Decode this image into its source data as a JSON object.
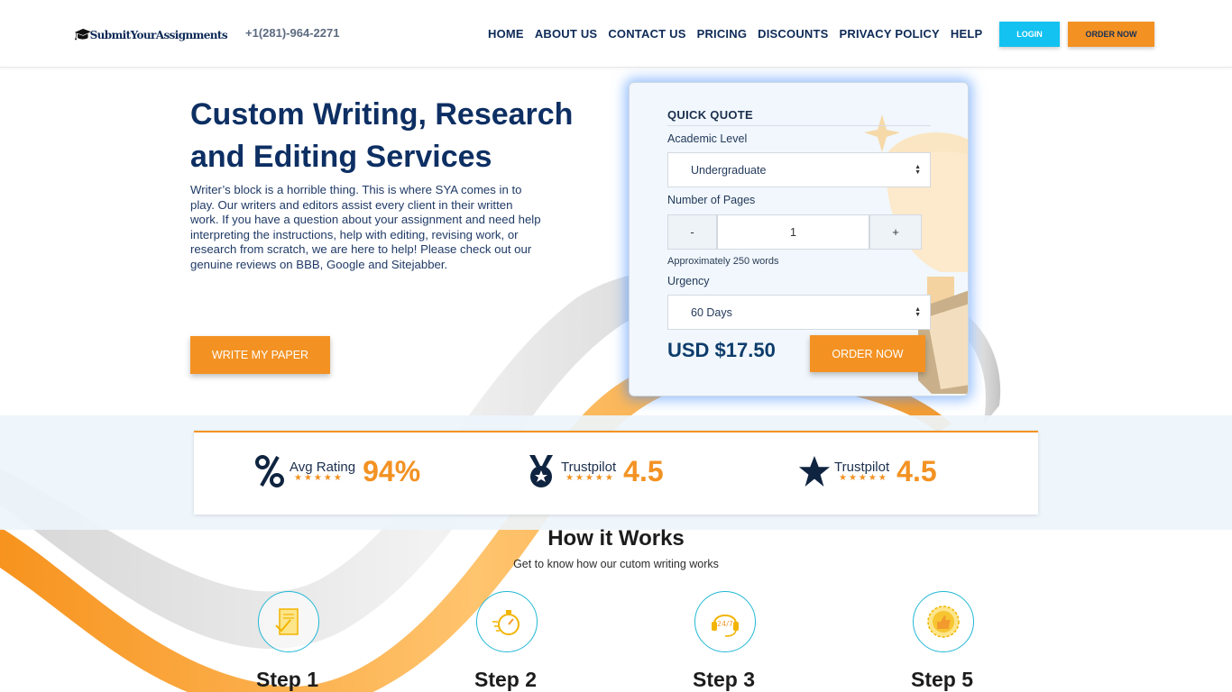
{
  "header": {
    "logo_text": "SubmitYourAssignments",
    "phone": "+1(281)-964-2271",
    "nav": [
      "HOME",
      "ABOUT US",
      "CONTACT US",
      "PRICING",
      "DISCOUNTS",
      "PRIVACY POLICY",
      "HELP"
    ],
    "login_label": "LOGIN",
    "order_label": "ORDER NOW"
  },
  "hero": {
    "title_line1": "Custom Writing, Research",
    "title_line2": "and Editing Services",
    "description": "Writer’s block is a horrible thing. This is where SYA comes in to play. Our writers and editors assist every client in their written work. If you have a question about your assignment and need help interpreting the instructions, help with editing, revising work, or research from scratch, we are here to help! Please check out our genuine reviews on BBB, Google and Sitejabber.",
    "cta_label": "WRITE MY PAPER"
  },
  "quote": {
    "title": "QUICK QUOTE",
    "academic_label": "Academic Level",
    "academic_value": "Undergraduate",
    "pages_label": "Number of Pages",
    "minus": "-",
    "pages_value": "1",
    "plus": "+",
    "approx": "Approximately 250 words",
    "urgency_label": "Urgency",
    "urgency_value": "60 Days",
    "price": "USD $17.50",
    "order_label": "ORDER NOW"
  },
  "ratings": [
    {
      "label": "Avg Rating",
      "stars": "★★★★★",
      "value": "94%",
      "icon": "percent-icon"
    },
    {
      "label": "Trustpilot",
      "stars": "★★★★★",
      "value": "4.5",
      "icon": "medal-icon"
    },
    {
      "label": "Trustpilot",
      "stars": "★★★★★",
      "value": "4.5",
      "icon": "star-icon"
    }
  ],
  "how": {
    "title": "How it Works",
    "subtitle": "Get to know how our cutom writing works",
    "steps": [
      {
        "name": "Step 1",
        "icon": "document-check-icon"
      },
      {
        "name": "Step 2",
        "icon": "stopwatch-icon"
      },
      {
        "name": "Step 3",
        "icon": "headset-24-7-icon"
      },
      {
        "name": "Step 5",
        "icon": "thumbs-up-badge-icon"
      }
    ]
  },
  "colors": {
    "brand_navy": "#0d2f63",
    "accent_orange": "#f39223",
    "login_cyan": "#13c2f1",
    "quote_glow": "#3f8cff"
  }
}
